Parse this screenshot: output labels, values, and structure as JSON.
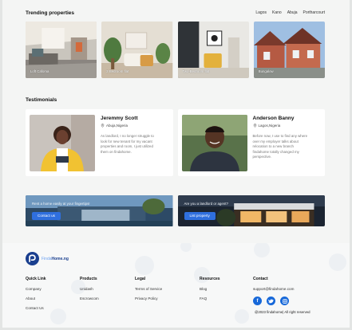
{
  "trending": {
    "title": "Trending properties",
    "cities": [
      "Lagos",
      "Kano",
      "Abuja",
      "Portharcourt"
    ],
    "properties": [
      {
        "label": "Loft Cafoma"
      },
      {
        "label": "3 Bedroom flat"
      },
      {
        "label": "Two-Bedroom flat"
      },
      {
        "label": "Bungalow"
      }
    ]
  },
  "testimonials": {
    "title": "Testimonials",
    "items": [
      {
        "name": "Jeremmy Scott",
        "location": "Abuja,Nigeria",
        "text": "As landlord, I no longer struggle to look for new tenant for my vacant properties and room, I just utilized them on findahome."
      },
      {
        "name": "Anderson Banny",
        "location": "Lagos,Nigeria",
        "text": "Before now, I use to find any where over my employer talks about relocation to a new branch findahome totally changed my perspective."
      }
    ]
  },
  "banners": [
    {
      "text": "Rent a home easily at your fingertips!",
      "button": "Contact us"
    },
    {
      "text": "Are you a landlord or agent?",
      "button": "List property"
    }
  ],
  "footer": {
    "logo_a": "Finda",
    "logo_b": "Home.ng",
    "columns": [
      {
        "title": "Quick Link",
        "links": [
          "Company",
          "About",
          "Contact Us"
        ]
      },
      {
        "title": "Products",
        "links": [
          "Unidash",
          "Escrowcom"
        ]
      },
      {
        "title": "Legal",
        "links": [
          "Terms of Service",
          "Privacy Policy"
        ]
      },
      {
        "title": "Resources",
        "links": [
          "Blog",
          "FAQ"
        ]
      }
    ],
    "contact": {
      "title": "Contact",
      "email": "support@findahome.com"
    },
    "copyright": "@2023 findahome| All right reserved"
  },
  "colors": {
    "accent": "#2f6fde",
    "social": "#1768d9",
    "logo_dark": "#1a3f8f"
  }
}
